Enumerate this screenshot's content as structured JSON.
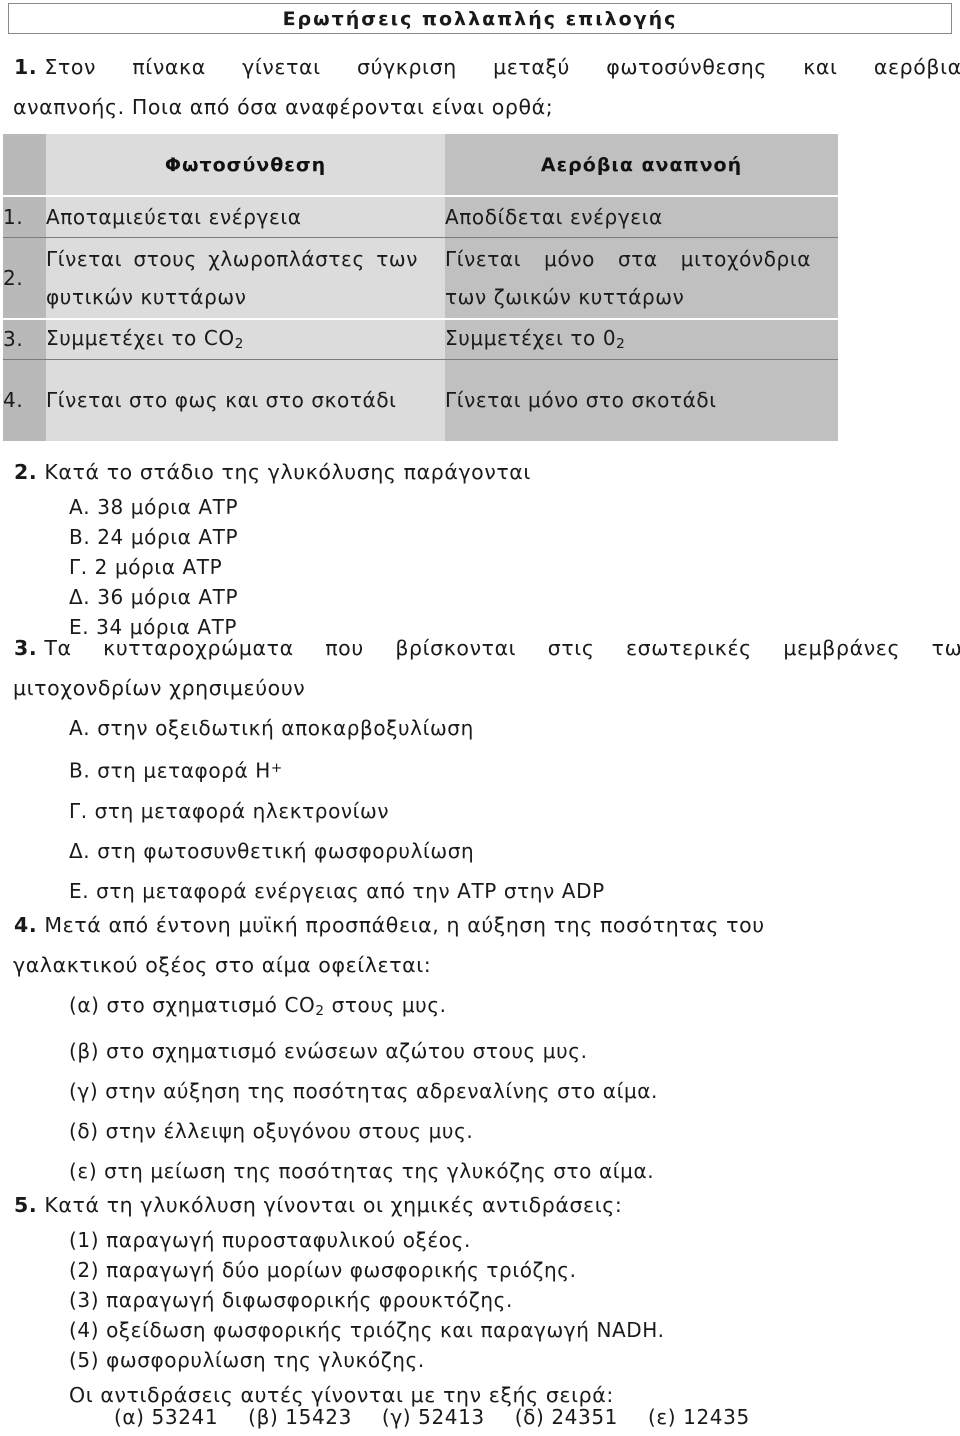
{
  "document": {
    "title": "Ερωτήσεις πολλαπλής επιλογής"
  },
  "question1": {
    "number": "1.",
    "text_line1": "Στον πίνακα γίνεται σύγκριση μεταξύ φωτοσύνθεσης και αερόβιας",
    "text_line2": "αναπνοής. Ποια από όσα αναφέρονται είναι ορθά;",
    "table": {
      "headers": {
        "num": "",
        "photosynthesis": "Φωτοσύνθεση",
        "respiration": "Αερόβια αναπνοή"
      },
      "rows": [
        {
          "num": "1.",
          "photosynthesis": "Αποταμιεύεται ενέργεια",
          "respiration": "Αποδίδεται ενέργεια"
        },
        {
          "num": "2.",
          "photosynthesis": "Γίνεται στους χλωροπλάστες των φυτικών κυττάρων",
          "respiration": "Γίνεται μόνο στα μιτοχόνδρια των ζωικών κυττάρων"
        },
        {
          "num": "3.",
          "photosynthesis_pre": "Συμμετέχει το CO",
          "photosynthesis_sub": "2",
          "respiration_pre": "Συμμετέχει το 0",
          "respiration_sub": "2"
        },
        {
          "num": "4.",
          "photosynthesis": "Γίνεται στο φως και στο σκοτάδι",
          "respiration": "Γίνεται μόνο στο σκοτάδι"
        }
      ]
    }
  },
  "question2": {
    "number": "2.",
    "text": "Κατά το στάδιο της γλυκόλυσης παράγονται",
    "options": [
      "Α. 38 μόρια ΑΤΡ",
      "Β. 24 μόρια ΑΤΡ",
      "Γ. 2 μόρια ΑΤΡ",
      "Δ. 36 μόρια ΑΤΡ",
      "Ε. 34 μόρια ΑΤΡ"
    ]
  },
  "question3": {
    "number": "3.",
    "text_line1": "Τα κυτταροχρώματα που βρίσκονται στις εσωτερικές μεμβράνες των",
    "text_line2": "μιτοχονδρίων χρησιμεύουν",
    "option_a": "Α. στην οξειδωτική αποκαρβοξυλίωση",
    "option_b_pre": "Β. στη μεταφορά Η",
    "option_b_sup": "+",
    "option_c": "Γ. στη μεταφορά ηλεκτρονίων",
    "option_d": "Δ. στη φωτοσυνθετική φωσφορυλίωση",
    "option_e": "Ε. στη μεταφορά ενέργειας από την ΑΤΡ στην ADP"
  },
  "question4": {
    "number": "4.",
    "text_line1": "Μετά από έντονη μυϊκή προσπάθεια, η αύξηση της ποσότητας του",
    "text_line2": "γαλακτικού οξέος στο αίμα οφείλεται:",
    "option_a_pre": "(α) στο σχηματισμό CO",
    "option_a_sub": "2",
    "option_a_post": " στους μυς.",
    "option_b": "(β) στο σχηματισμό ενώσεων αζώτου στους μυς.",
    "option_c": "(γ) στην αύξηση της ποσότητας αδρεναλίνης στο αίμα.",
    "option_d": "(δ) στην έλλειψη οξυγόνου στους μυς.",
    "option_e": "(ε) στη μείωση της ποσότητας της γλυκόζης στο αίμα."
  },
  "question5": {
    "number": "5.",
    "text": "Κατά τη γλυκόλυση γίνονται οι χημικές αντιδράσεις:",
    "reactions": [
      "(1) παραγωγή πυροσταφυλικού οξέος.",
      "(2) παραγωγή δύο μορίων φωσφορικής τριόζης.",
      "(3) παραγωγή διφωσφορικής φρουκτόζης.",
      "(4) οξείδωση φωσφορικής τριόζης και παραγωγή NADH.",
      "(5) φωσφορυλίωση της γλυκόζης."
    ],
    "order_prompt": "Οι αντιδράσεις αυτές γίνονται με την εξής σειρά:",
    "answers": [
      "(α) 53241",
      "(β) 15423",
      "(γ) 52413",
      "(δ) 24351",
      "(ε) 12435"
    ]
  }
}
